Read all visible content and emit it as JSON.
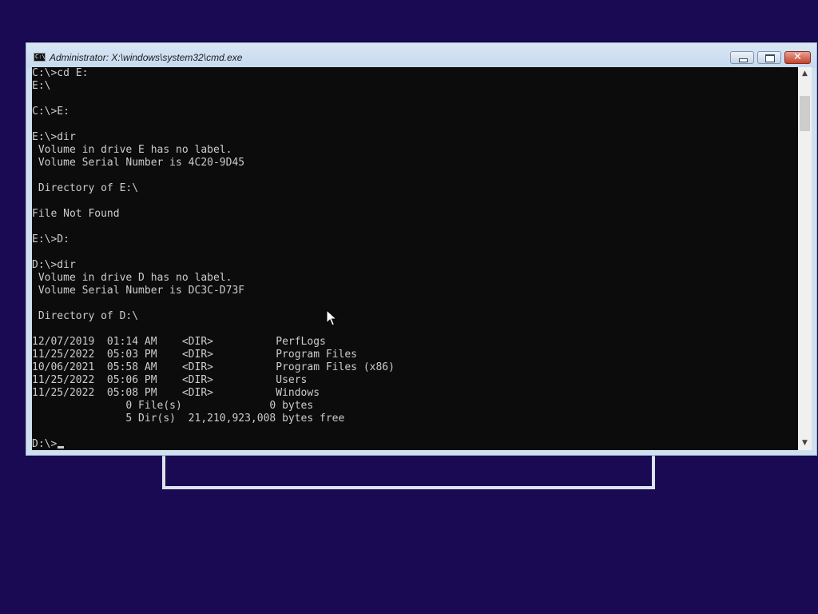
{
  "window": {
    "title": "Administrator: X:\\windows\\system32\\cmd.exe",
    "icon_label": "C:\\",
    "buttons": {
      "minimize": "minimize-icon",
      "maximize": "maximize-icon",
      "close": "✕"
    }
  },
  "console": {
    "lines": [
      "C:\\>cd E:",
      "E:\\",
      "",
      "C:\\>E:",
      "",
      "E:\\>dir",
      " Volume in drive E has no label.",
      " Volume Serial Number is 4C20-9D45",
      "",
      " Directory of E:\\",
      "",
      "File Not Found",
      "",
      "E:\\>D:",
      "",
      "D:\\>dir",
      " Volume in drive D has no label.",
      " Volume Serial Number is DC3C-D73F",
      "",
      " Directory of D:\\",
      "",
      "12/07/2019  01:14 AM    <DIR>          PerfLogs",
      "11/25/2022  05:03 PM    <DIR>          Program Files",
      "10/06/2021  05:58 AM    <DIR>          Program Files (x86)",
      "11/25/2022  05:06 PM    <DIR>          Users",
      "11/25/2022  05:08 PM    <DIR>          Windows",
      "               0 File(s)              0 bytes",
      "               5 Dir(s)  21,210,923,008 bytes free",
      ""
    ],
    "prompt": "D:\\>"
  },
  "scrollbar": {
    "up_arrow": "▲",
    "down_arrow": "▼"
  },
  "colors": {
    "desktop": "#1a0a54",
    "console_bg": "#0c0c0c",
    "console_fg": "#cccccc",
    "window_frame": "#cfe0f0",
    "close_button": "#c5432d"
  }
}
